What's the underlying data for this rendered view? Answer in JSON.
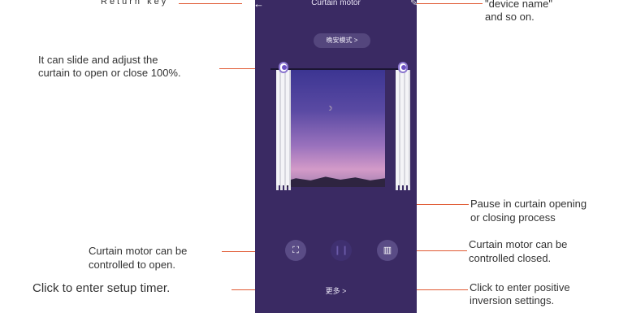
{
  "phone": {
    "title": "Curtain motor",
    "back_icon": "←",
    "edit_icon": "✎",
    "mode_button_label": "晚安模式 >",
    "moon": "☽",
    "controls": {
      "open_icon": "⛶",
      "pause_icon": "❙❙",
      "close_icon": "▥"
    },
    "more_label": "更多 >"
  },
  "annotations": {
    "return_key": "Return key",
    "device_name_line1": "\"device name\"",
    "device_name_line2": "and so on.",
    "slide_line1": "It can slide and adjust the",
    "slide_line2": "curtain to open or close 100%.",
    "pause_line1": "Pause in curtain opening",
    "pause_line2": "or closing process",
    "open_line1": "Curtain motor can be",
    "open_line2": "controlled to open.",
    "closed_line1": "Curtain motor can be",
    "closed_line2": "controlled closed.",
    "timer": "Click to enter setup timer.",
    "inversion_line1": "Click to enter positive",
    "inversion_line2": "inversion settings."
  },
  "colors": {
    "phone_bg": "#3a2a63",
    "leader": "#e05a33"
  }
}
